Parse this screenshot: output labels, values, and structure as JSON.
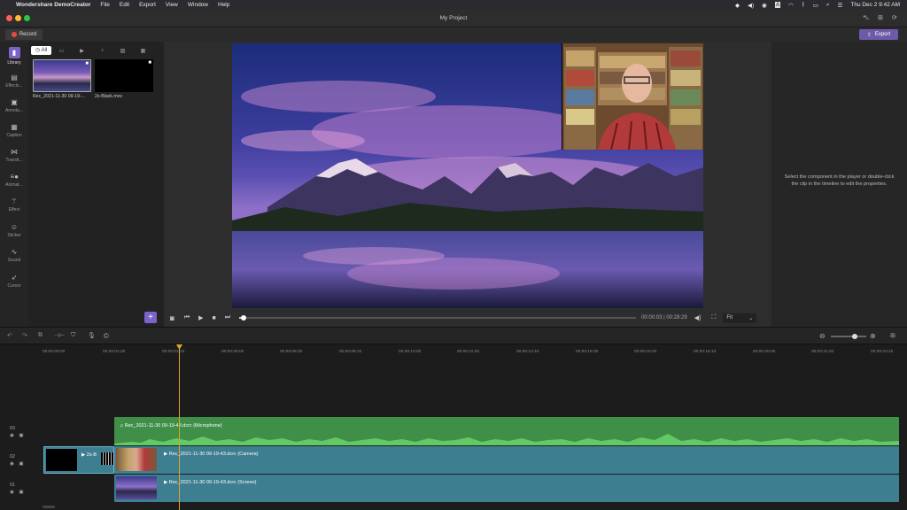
{
  "menubar": {
    "apple": "",
    "app_name": "Wondershare DemoCreator",
    "items": [
      "File",
      "Edit",
      "Export",
      "View",
      "Window",
      "Help"
    ],
    "clock": "Thu Dec 2  9:42 AM"
  },
  "window": {
    "title": "My Project"
  },
  "toolbar": {
    "record_label": "Record",
    "export_label": "Export"
  },
  "sidebar": {
    "items": [
      {
        "label": "Library",
        "icon": "library-icon"
      },
      {
        "label": "Effects...",
        "icon": "effects-icon"
      },
      {
        "label": "Annota...",
        "icon": "annotation-icon"
      },
      {
        "label": "Caption",
        "icon": "caption-icon"
      },
      {
        "label": "Transit...",
        "icon": "transition-icon"
      },
      {
        "label": "Animat...",
        "icon": "animation-icon"
      },
      {
        "label": "Effect",
        "icon": "effect-icon"
      },
      {
        "label": "Sticker",
        "icon": "sticker-icon"
      },
      {
        "label": "Sound",
        "icon": "sound-icon"
      },
      {
        "label": "Cursor",
        "icon": "cursor-icon"
      }
    ]
  },
  "library": {
    "filter_all": "All",
    "media": [
      {
        "name": "Rec_2021-11-30 09-19-..."
      },
      {
        "name": "2s-Black.mov"
      }
    ]
  },
  "player": {
    "timecode": "00:00:03 | 00:28:29",
    "fit_label": "Fit",
    "progress": 0.01
  },
  "properties": {
    "hint": "Select the component in the player or double-click the clip in the timeline to edit the properties."
  },
  "ruler": {
    "ticks": [
      "00:00:00:00",
      "00:00:01:20",
      "00:00:03:10",
      "00:00:05:00",
      "00:00:06:20",
      "00:00:08:10",
      "00:00:10:00",
      "00:00:11:20",
      "00:00:13:10",
      "00:00:15:00",
      "00:00:16:20",
      "00:00:18:10",
      "00:00:20:00",
      "00:00:21:20",
      "00:00:23:10"
    ]
  },
  "tracks": [
    {
      "num": "03",
      "clip": "Rec_2021-11-30 09-19-43.dcrc (Microphone)"
    },
    {
      "num": "02",
      "clip": "Rec_2021-11-30 09-19-43.dcrc (Camera)",
      "small_clip": "2s-B"
    },
    {
      "num": "01",
      "clip": "Rec_2021-11-30 09-19-43.dcrc (Screen)"
    }
  ],
  "colors": {
    "accent": "#7b63c9",
    "track_video": "#3e7e91",
    "track_audio": "#3f8f48",
    "playhead": "#e0a526"
  }
}
